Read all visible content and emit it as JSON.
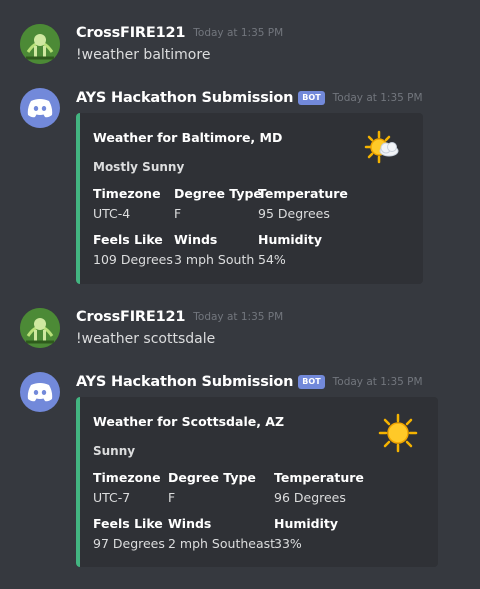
{
  "messages": [
    {
      "author": "CrossFIRE121",
      "timestamp": "Today at 1:35 PM",
      "text": "!weather baltimore"
    },
    {
      "author": "AYS Hackathon Submission",
      "badge": "BOT",
      "timestamp": "Today at 1:35 PM",
      "embed": {
        "title": "Weather for Baltimore, MD",
        "description": "Mostly Sunny",
        "icon": "partly-sunny-icon",
        "fields": [
          {
            "name": "Timezone",
            "value": "UTC-4"
          },
          {
            "name": "Degree Type",
            "value": "F"
          },
          {
            "name": "Temperature",
            "value": "95 Degrees"
          },
          {
            "name": "Feels Like",
            "value": "109 Degrees"
          },
          {
            "name": "Winds",
            "value": "3 mph South"
          },
          {
            "name": "Humidity",
            "value": "54%"
          }
        ]
      }
    },
    {
      "author": "CrossFIRE121",
      "timestamp": "Today at 1:35 PM",
      "text": "!weather scottsdale"
    },
    {
      "author": "AYS Hackathon Submission",
      "badge": "BOT",
      "timestamp": "Today at 1:35 PM",
      "embed": {
        "title": "Weather for Scottsdale, AZ",
        "description": "Sunny",
        "icon": "sun-icon",
        "fields": [
          {
            "name": "Timezone",
            "value": "UTC-7"
          },
          {
            "name": "Degree Type",
            "value": "F"
          },
          {
            "name": "Temperature",
            "value": "96 Degrees"
          },
          {
            "name": "Feels Like",
            "value": "97 Degrees"
          },
          {
            "name": "Winds",
            "value": "2 mph Southeast"
          },
          {
            "name": "Humidity",
            "value": "33%"
          }
        ]
      }
    }
  ],
  "colors": {
    "background": "#36393f",
    "embed_background": "#2f3136",
    "embed_accent": "#43b581",
    "bot_badge": "#7289da",
    "timestamp": "#72767d"
  }
}
